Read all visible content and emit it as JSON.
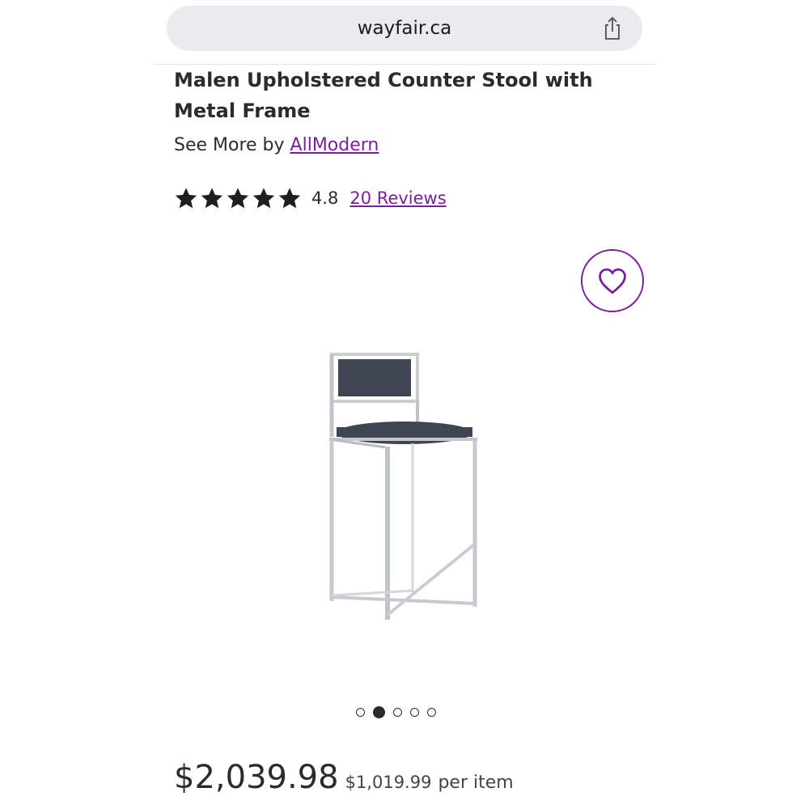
{
  "browser": {
    "url": "wayfair.ca",
    "share_icon": "share-icon"
  },
  "product": {
    "title": "Malen Upholstered Counter Stool with Metal Frame",
    "see_more_prefix": "See More by",
    "brand": "AllModern",
    "rating": {
      "stars": 5,
      "value": "4.8",
      "reviews_link": "20 Reviews"
    },
    "favorite_icon": "heart-icon",
    "carousel": {
      "count": 5,
      "active_index": 1
    },
    "price": "$2,039.98",
    "unit_price": "$1,019.99",
    "unit_suffix": "per item"
  },
  "colors": {
    "accent": "#7b1fa2",
    "text": "#2b2b2b",
    "urlbar": "#e9ebee"
  }
}
